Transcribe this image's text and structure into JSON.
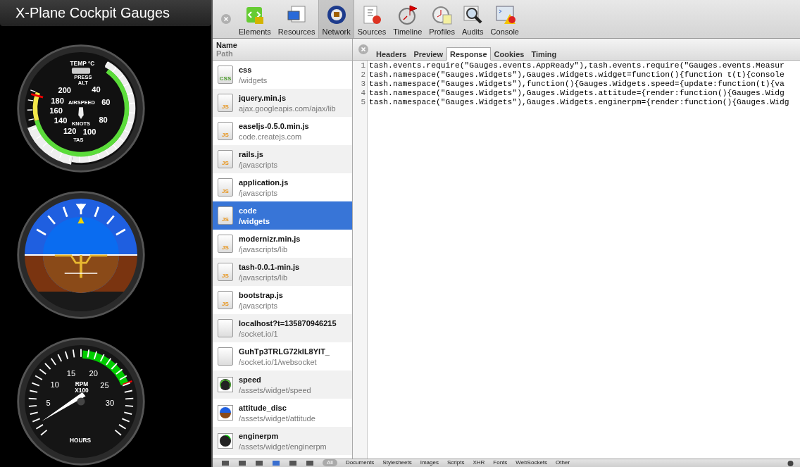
{
  "app_title": "X-Plane Cockpit Gauges",
  "gauges": [
    {
      "kind": "airspeed",
      "labels": [
        "TEMP °C",
        "PRESS",
        "ALT",
        "200",
        "40",
        "180",
        "AIRSPEED",
        "60",
        "160",
        "140",
        "KNOTS",
        "80",
        "120",
        "100",
        "TAS"
      ]
    },
    {
      "kind": "attitude"
    },
    {
      "kind": "rpm",
      "labels": [
        "15",
        "20",
        "10",
        "RPM",
        "25",
        "X100",
        "5",
        "30",
        "HOURS"
      ]
    }
  ],
  "devtools": {
    "toolbar": [
      {
        "label": "Elements",
        "selected": false
      },
      {
        "label": "Resources",
        "selected": false
      },
      {
        "label": "Network",
        "selected": true
      },
      {
        "label": "Sources",
        "selected": false
      },
      {
        "label": "Timeline",
        "selected": false
      },
      {
        "label": "Profiles",
        "selected": false
      },
      {
        "label": "Audits",
        "selected": false
      },
      {
        "label": "Console",
        "selected": false
      }
    ],
    "list_header": {
      "name": "Name",
      "path": "Path"
    },
    "requests": [
      {
        "kind": "css",
        "badge": "CSS",
        "name": "css",
        "path": "/widgets",
        "selected": false
      },
      {
        "kind": "js",
        "badge": "JS",
        "name": "jquery.min.js",
        "path": "ajax.googleapis.com/ajax/lib",
        "selected": false
      },
      {
        "kind": "js",
        "badge": "JS",
        "name": "easeljs-0.5.0.min.js",
        "path": "code.createjs.com",
        "selected": false
      },
      {
        "kind": "js",
        "badge": "JS",
        "name": "rails.js",
        "path": "/javascripts",
        "selected": false
      },
      {
        "kind": "js",
        "badge": "JS",
        "name": "application.js",
        "path": "/javascripts",
        "selected": false
      },
      {
        "kind": "js",
        "badge": "JS",
        "name": "code",
        "path": "/widgets",
        "selected": true
      },
      {
        "kind": "js",
        "badge": "JS",
        "name": "modernizr.min.js",
        "path": "/javascripts/lib",
        "selected": false
      },
      {
        "kind": "js",
        "badge": "JS",
        "name": "tash-0.0.1-min.js",
        "path": "/javascripts/lib",
        "selected": false
      },
      {
        "kind": "js",
        "badge": "JS",
        "name": "bootstrap.js",
        "path": "/javascripts",
        "selected": false
      },
      {
        "kind": "blank",
        "name": "localhost?t=135870946215",
        "path": "/socket.io/1",
        "selected": false
      },
      {
        "kind": "blank",
        "name": "GuhTp3TRLG72kIL8YlT_",
        "path": "/socket.io/1/websocket",
        "selected": false
      },
      {
        "kind": "speed",
        "name": "speed",
        "path": "/assets/widget/speed",
        "selected": false
      },
      {
        "kind": "attitude",
        "name": "attitude_disc",
        "path": "/assets/widget/attitude",
        "selected": false
      },
      {
        "kind": "rpm",
        "name": "enginerpm",
        "path": "/assets/widget/enginerpm",
        "selected": false
      }
    ],
    "detail_tabs": [
      {
        "label": "Headers",
        "selected": false
      },
      {
        "label": "Preview",
        "selected": false
      },
      {
        "label": "Response",
        "selected": true
      },
      {
        "label": "Cookies",
        "selected": false
      },
      {
        "label": "Timing",
        "selected": false
      }
    ],
    "response_lines": [
      {
        "number": "1",
        "code": "tash.events.require(\"Gauges.events.AppReady\"),tash.events.require(\"Gauges.events.Measur"
      },
      {
        "number": "2",
        "code": "tash.namespace(\"Gauges.Widgets\"),Gauges.Widgets.widget=function(){function t(t){console"
      },
      {
        "number": "3",
        "code": "tash.namespace(\"Gauges.Widgets\"),function(){Gauges.Widgets.speed={update:function(t){va"
      },
      {
        "number": "4",
        "code": "tash.namespace(\"Gauges.Widgets\"),Gauges.Widgets.attitude={render:function(){Gauges.Widg"
      },
      {
        "number": "5",
        "code": "tash.namespace(\"Gauges.Widgets\"),Gauges.Widgets.enginerpm={render:function(){Gauges.Widg"
      }
    ],
    "filter_bar": {
      "all": "All",
      "types": [
        "Documents",
        "Stylesheets",
        "Images",
        "Scripts",
        "XHR",
        "Fonts",
        "WebSockets",
        "Other"
      ]
    }
  }
}
